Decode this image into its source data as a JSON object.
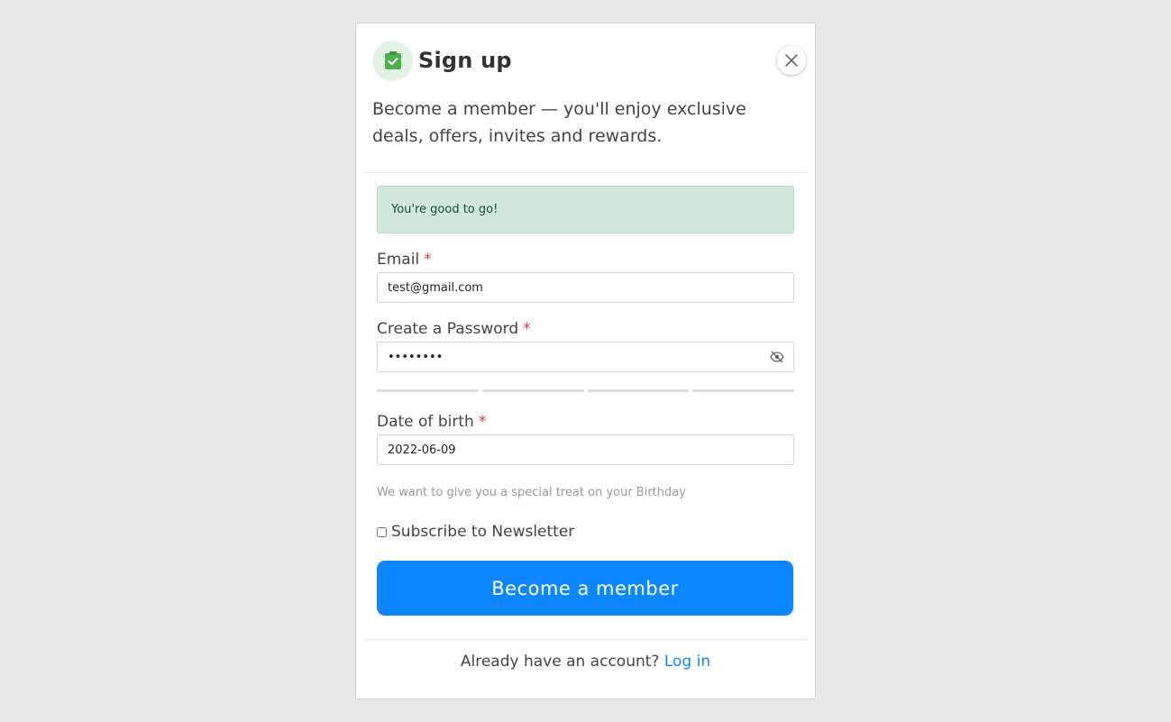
{
  "modal": {
    "title": "Sign up",
    "subtitle": "Become a member — you'll enjoy exclusive deals, offers, invites and rewards.",
    "logo_icon": "clipboard-check-icon",
    "close_icon": "close-icon"
  },
  "alert": {
    "text": "You're good to go!"
  },
  "form": {
    "email": {
      "label": "Email",
      "required_mark": "*",
      "value": "test@gmail.com"
    },
    "password": {
      "label": "Create a Password",
      "required_mark": "*",
      "value": "••••••••",
      "toggle_icon": "eye-slash-icon"
    },
    "dob": {
      "label": "Date of birth",
      "required_mark": "*",
      "value": "2022-06-09",
      "hint": "We want to give you a special treat on your Birthday"
    },
    "newsletter": {
      "label": "Subscribe to Newsletter",
      "checked": false
    },
    "submit_label": "Become a member"
  },
  "footer": {
    "prompt": "Already have an account?",
    "link": "Log in"
  },
  "colors": {
    "primary": "#0d87ff",
    "success_bg": "#d1e7dd",
    "success_text": "#0f5132",
    "required": "#dc3545",
    "logo_green": "#4caf50"
  }
}
